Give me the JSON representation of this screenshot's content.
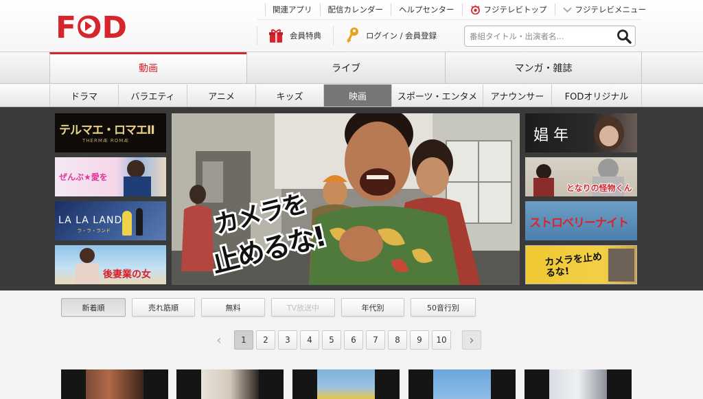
{
  "header": {
    "logo_text": "FOD",
    "top_links": [
      "関連アプリ",
      "配信カレンダー",
      "ヘルプセンター",
      "フジテレビトップ",
      "フジテレビメニュー"
    ],
    "member_label": "会員特典",
    "login_label": "ログイン / 会員登録",
    "search_placeholder": "番組タイトル・出演者名..."
  },
  "main_tabs": [
    "動画",
    "ライブ",
    "マンガ・雑誌"
  ],
  "sub_tabs": [
    "ドラマ",
    "バラエティ",
    "アニメ",
    "キッズ",
    "映画",
    "スポーツ・エンタメ",
    "アナウンサー",
    "FODオリジナル"
  ],
  "hero": {
    "left_thumbs": [
      {
        "title": "テルマエ・ロマエII",
        "sub": "THERMÆ ROMÆ"
      },
      {
        "title": "ぜんぶ★愛を",
        "sub": ""
      },
      {
        "title": "LA LA LAND",
        "sub": "ラ・ラ・ランド"
      },
      {
        "title": "後妻業の女",
        "sub": ""
      }
    ],
    "main_title_line1": "カメラを",
    "main_title_line2": "止めるな!",
    "right_thumbs": [
      {
        "title": "娼 年"
      },
      {
        "title": "となりの怪物くん"
      },
      {
        "title": "ストロベリーナイト"
      },
      {
        "title": "カメラを止めるな!"
      }
    ]
  },
  "filters": [
    "新着順",
    "売れ筋順",
    "無料",
    "TV放送中",
    "年代別",
    "50音行別"
  ],
  "pagination": {
    "pages": [
      "1",
      "2",
      "3",
      "4",
      "5",
      "6",
      "7",
      "8",
      "9",
      "10"
    ],
    "current": "1",
    "prev": "‹",
    "next": "›"
  },
  "colors": {
    "brand_red": "#d6252d",
    "dark_band": "#3a3a3a",
    "active_subtab": "#777777"
  }
}
